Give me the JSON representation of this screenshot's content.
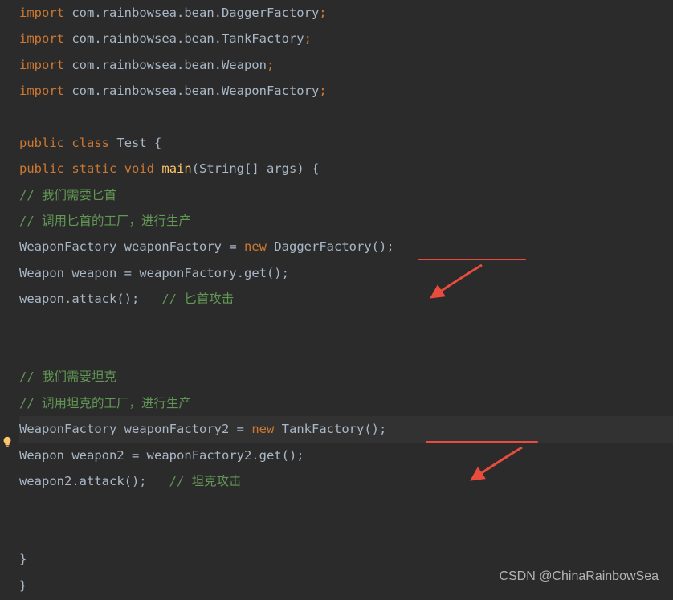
{
  "imports": [
    {
      "keyword": "import",
      "path": "com.rainbowsea.bean.DaggerFactory"
    },
    {
      "keyword": "import",
      "path": "com.rainbowsea.bean.TankFactory"
    },
    {
      "keyword": "import",
      "path": "com.rainbowsea.bean.Weapon"
    },
    {
      "keyword": "import",
      "path": "com.rainbowsea.bean.WeaponFactory"
    }
  ],
  "class_decl": {
    "public": "public",
    "class": "class",
    "name": "Test",
    "brace": "{"
  },
  "main_decl": {
    "public": "public",
    "static": "static",
    "void": "void",
    "main": "main",
    "params": "(String[] args) {"
  },
  "comments": {
    "c1": "// 我们需要匕首",
    "c2": "// 调用匕首的工厂，进行生产",
    "c3": "// 匕首攻击",
    "c4": "// 我们需要坦克",
    "c5": "// 调用坦克的工厂，进行生产",
    "c6": "// 坦克攻击"
  },
  "code": {
    "l1_type": "WeaponFactory",
    "l1_var": "weaponFactory",
    "l1_eq": " = ",
    "l1_new": "new",
    "l1_class": "DaggerFactory",
    "l1_end": "();",
    "l2_type": "Weapon",
    "l2_var": "weapon",
    "l2_eq": " = weaponFactory.get();",
    "l3": "weapon.attack();",
    "l4_type": "WeaponFactory",
    "l4_var": "weaponFactory2",
    "l4_eq": " = ",
    "l4_new": "new",
    "l4_class": "TankFactory",
    "l4_end": "();",
    "l5_type": "Weapon",
    "l5_var": "weapon2",
    "l5_eq": " = weaponFactory2.get();",
    "l6": "weapon2.attack();"
  },
  "braces": {
    "close_method": "}",
    "close_class": "}"
  },
  "watermark": "CSDN @ChinaRainbowSea"
}
